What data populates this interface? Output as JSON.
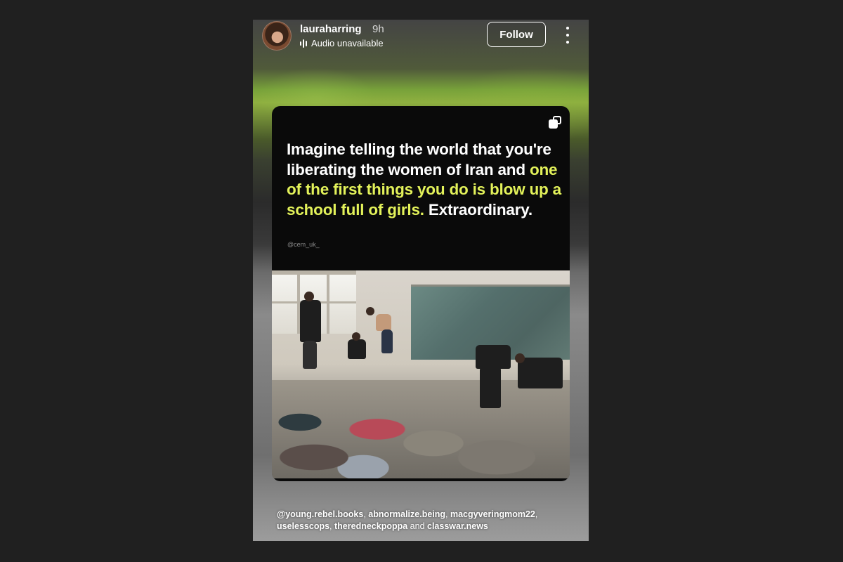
{
  "header": {
    "username": "lauraharring",
    "time": "9h",
    "audio_status": "Audio unavailable",
    "follow_label": "Follow"
  },
  "post": {
    "headline_part1": "Imagine telling the world that you're liberating the women of Iran and ",
    "headline_highlight": "one of the first things you do is blow up a school full of girls.",
    "headline_part2": " Extraordinary.",
    "credit": "@cem_uk_",
    "highlight_color": "#e3f25a"
  },
  "mentions": {
    "m1": "@young.rebel.books",
    "sep1": ", ",
    "m2": "abnormalize.being",
    "sep2": ", ",
    "m3": "macgyveringmom22",
    "sep3": ", ",
    "m4": "uselesscops",
    "sep4": ", ",
    "m5": "theredneckpoppa",
    "and": " and ",
    "m6": "classwar.news"
  },
  "icons": {
    "audio": "audio-bars-icon",
    "more": "more-vertical-icon",
    "copy": "carousel-copy-icon"
  }
}
